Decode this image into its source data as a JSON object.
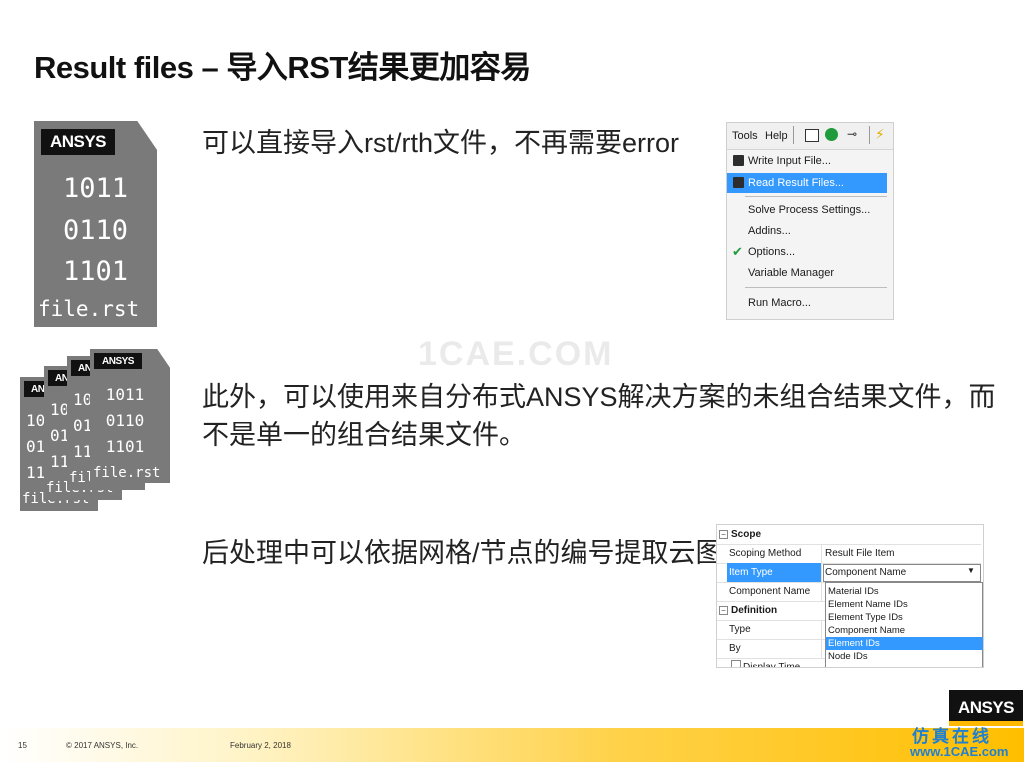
{
  "slide": {
    "title": "Result files – 导入RST结果更加容易",
    "point1": "可以直接导入rst/rth文件，不再需要error",
    "point2_line1": "此外，可以使用来自分布式ANSYS解决方案的未组合结果文件，而",
    "point2_line2": "不是单一的组合结果文件。",
    "point3": "后处理中可以依据网格/节点的编号提取云图"
  },
  "file_icon": {
    "logo": "ANSYS",
    "lines": [
      "1011",
      "0110",
      "1101"
    ],
    "filename": "file.rst"
  },
  "menu_screenshot": {
    "menubar": [
      "Tools",
      "Help"
    ],
    "items": [
      {
        "label": "Write Input File...",
        "highlighted": false,
        "icon": "disk-icon"
      },
      {
        "label": "Read Result Files...",
        "highlighted": true,
        "icon": "disk-icon"
      },
      {
        "label": "Solve Process Settings...",
        "highlighted": false,
        "icon": ""
      },
      {
        "label": "Addins...",
        "highlighted": false,
        "icon": ""
      },
      {
        "label": "Options...",
        "highlighted": false,
        "icon": "check-icon"
      },
      {
        "label": "Variable Manager",
        "highlighted": false,
        "icon": ""
      },
      {
        "label": "Run Macro...",
        "highlighted": false,
        "icon": ""
      }
    ]
  },
  "details_panel": {
    "scope_header": "Scope",
    "rows": [
      {
        "key": "Scoping Method",
        "value": "Result File Item"
      },
      {
        "key": "Item Type",
        "value": "Component Name"
      },
      {
        "key": "Component Name",
        "value": ""
      }
    ],
    "definition_header": "Definition",
    "def_rows": [
      {
        "key": "Type",
        "value": ""
      },
      {
        "key": "By",
        "value": ""
      },
      {
        "key": "Display Time",
        "value": ""
      }
    ],
    "dropdown_options": [
      "Material IDs",
      "Element Name IDs",
      "Element Type IDs",
      "Component Name",
      "Element IDs",
      "Node IDs"
    ],
    "dropdown_selected": "Element IDs"
  },
  "footer": {
    "page": "15",
    "copyright": "© 2017 ANSYS, Inc.",
    "date": "February 2, 2018",
    "logo": "ANSYS",
    "watermark_cn": "仿真在线",
    "watermark_url": "www.1CAE.com",
    "mid_watermark": "1CAE.COM"
  },
  "colors": {
    "highlight": "#3399ff",
    "file_gray": "#7a7a7a",
    "footer_gold": "#ffbf00",
    "watermark_blue": "#1f7fd1"
  }
}
